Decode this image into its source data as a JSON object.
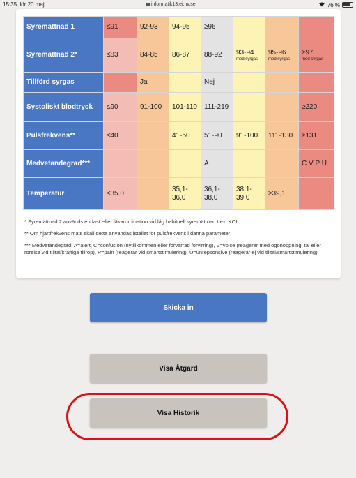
{
  "status": {
    "time": "15:35",
    "date": "lör 20 maj",
    "url": "informatik13.ei.hv.se",
    "battery": "76 %"
  },
  "rows": [
    {
      "label": "Syremättnad 1",
      "cells": [
        {
          "t": "≤91",
          "c": "r"
        },
        {
          "t": "92-93",
          "c": "o"
        },
        {
          "t": "94-95",
          "c": "y"
        },
        {
          "t": "≥96",
          "c": "g"
        },
        {
          "t": "",
          "c": "y"
        },
        {
          "t": "",
          "c": "o"
        },
        {
          "t": "",
          "c": "r"
        }
      ]
    },
    {
      "label": "Syremättnad 2*",
      "cells": [
        {
          "t": "≤83",
          "c": "p"
        },
        {
          "t": "84-85",
          "c": "o"
        },
        {
          "t": "86-87",
          "c": "y"
        },
        {
          "t": "88-92",
          "c": "g"
        },
        {
          "t": "93-94",
          "s": "med syrgas",
          "c": "y"
        },
        {
          "t": "95-96",
          "s": "med syrgas",
          "c": "o"
        },
        {
          "t": "≥97",
          "s": "med syrgas",
          "c": "r"
        }
      ]
    },
    {
      "label": "Tillförd syrgas",
      "cells": [
        {
          "t": "",
          "c": "r"
        },
        {
          "t": "Ja",
          "c": "o"
        },
        {
          "t": "",
          "c": "y"
        },
        {
          "t": "Nej",
          "c": "g"
        },
        {
          "t": "",
          "c": "y"
        },
        {
          "t": "",
          "c": "o"
        },
        {
          "t": "",
          "c": "r"
        }
      ]
    },
    {
      "label": "Systoliskt blodtryck",
      "cells": [
        {
          "t": "≤90",
          "c": "p"
        },
        {
          "t": "91-100",
          "c": "o"
        },
        {
          "t": "101-110",
          "c": "y"
        },
        {
          "t": "111-219",
          "c": "g"
        },
        {
          "t": "",
          "c": "y"
        },
        {
          "t": "",
          "c": "o"
        },
        {
          "t": "≥220",
          "c": "r"
        }
      ]
    },
    {
      "label": "Pulsfrekvens**",
      "cells": [
        {
          "t": "≤40",
          "c": "p"
        },
        {
          "t": "",
          "c": "o"
        },
        {
          "t": "41-50",
          "c": "y"
        },
        {
          "t": "51-90",
          "c": "g"
        },
        {
          "t": "91-100",
          "c": "y"
        },
        {
          "t": "111-130",
          "c": "o"
        },
        {
          "t": "≥131",
          "c": "r"
        }
      ]
    },
    {
      "label": "Medvetandegrad***",
      "cells": [
        {
          "t": "",
          "c": "p"
        },
        {
          "t": "",
          "c": "o"
        },
        {
          "t": "",
          "c": "y"
        },
        {
          "t": "A",
          "c": "g"
        },
        {
          "t": "",
          "c": "y"
        },
        {
          "t": "",
          "c": "o"
        },
        {
          "t": "C V P U",
          "c": "r"
        }
      ]
    },
    {
      "label": "Temperatur",
      "cells": [
        {
          "t": "≤35.0",
          "c": "p"
        },
        {
          "t": "",
          "c": "o"
        },
        {
          "t": "35,1-36,0",
          "c": "y"
        },
        {
          "t": "36,1-38,0",
          "c": "g"
        },
        {
          "t": "38,1-39,0",
          "c": "y"
        },
        {
          "t": "≥39,1",
          "c": "o"
        },
        {
          "t": "",
          "c": "r"
        }
      ]
    }
  ],
  "notes": {
    "n1": "* Syremättnad 2 används endast efter läkarordination vid låg habituell syremättnad t.ex. KOL",
    "n2": "** Om hjärtfrekvens mäts skall detta användas istället för pulsfrekvens i danna parameter",
    "n3": "*** Medvetandegrad: A=alert, C=confusion (nytillkommen eller förvärrad förvirring), V=voice (reagerar med ögonöppning, tal eller röreise vid tilltal/kraftiga tillrop), P=pain (reagerar vid smärtstimulering), U=unrepsonsive (reagerar ej vid tilltal/smärtstimulering)"
  },
  "buttons": {
    "submit": "Skicka in",
    "show_action": "Visa Åtgärd",
    "show_history": "Visa Historik"
  },
  "colors": {
    "header_blue": "#4a77c4",
    "red": "#ea8a80",
    "orange": "#f7c79a",
    "pink": "#f3bdb6",
    "yellow": "#fdf3b4",
    "gray": "#e3e3e3",
    "highlight": "#e01010"
  }
}
